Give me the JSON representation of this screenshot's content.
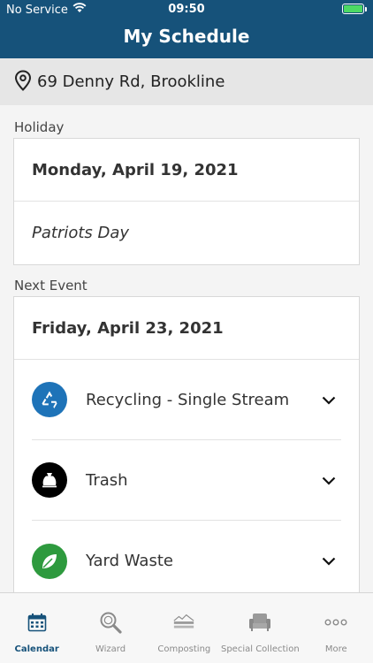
{
  "status_bar": {
    "carrier": "No Service",
    "time": "09:50"
  },
  "header": {
    "title": "My Schedule"
  },
  "address": {
    "text": "69 Denny Rd, Brookline",
    "icon": "location-pin-icon"
  },
  "holiday_section": {
    "label": "Holiday",
    "date": "Monday, April 19, 2021",
    "name": "Patriots Day"
  },
  "next_event_section": {
    "label": "Next Event",
    "date": "Friday, April 23, 2021",
    "items": [
      {
        "label": "Recycling - Single Stream",
        "icon": "recycle-icon",
        "color": "#1e73b8"
      },
      {
        "label": "Trash",
        "icon": "trash-bag-icon",
        "color": "#000000"
      },
      {
        "label": "Yard Waste",
        "icon": "leaf-icon",
        "color": "#2e9a3e"
      }
    ]
  },
  "tab_bar": {
    "tabs": [
      {
        "label": "Calendar",
        "icon": "calendar-icon",
        "active": true
      },
      {
        "label": "Wizard",
        "icon": "wizard-search-icon",
        "active": false
      },
      {
        "label": "Composting",
        "icon": "black-earth-compost-logo",
        "active": false
      },
      {
        "label": "Special Collection",
        "icon": "armchair-icon",
        "active": false
      },
      {
        "label": "More",
        "icon": "more-dots-icon",
        "active": false
      }
    ]
  },
  "colors": {
    "brand": "#16527a",
    "battery": "#4cd964"
  }
}
